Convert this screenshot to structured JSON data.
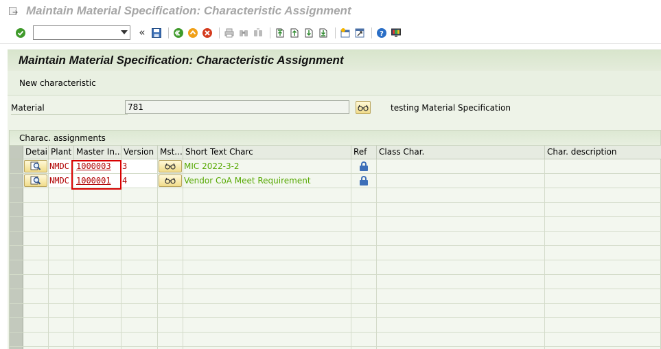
{
  "window": {
    "title": "Maintain Material Specification: Characteristic Assignment"
  },
  "toolbar": {
    "command_value": "",
    "icons": [
      "enter-check-icon",
      "back-double-chevron-icon",
      "save-icon",
      "back-icon",
      "exit-icon",
      "cancel-icon",
      "print-icon",
      "find-icon",
      "find-next-icon",
      "first-page-icon",
      "previous-page-icon",
      "next-page-icon",
      "last-page-icon",
      "create-session-icon",
      "shortcut-icon",
      "help-icon",
      "customize-layout-icon"
    ]
  },
  "header": {
    "title": "Maintain Material Specification: Characteristic Assignment"
  },
  "app_toolbar": {
    "new_characteristic": "New characteristic"
  },
  "material": {
    "label": "Material",
    "value": "781",
    "description": "testing Material Specification"
  },
  "assignments": {
    "title": "Charac. assignments",
    "columns": {
      "detail": "Detail",
      "plant": "Plant",
      "master": "Master In...",
      "version": "Version",
      "mst": "Mst...",
      "short_text": "Short Text Charc",
      "ref": "Ref",
      "class_char": "Class Char.",
      "char_desc": "Char. description"
    },
    "rows": [
      {
        "plant": "NMDC",
        "master": "1000003",
        "version": "3",
        "short_text": "MIC 2022-3-2",
        "class_char": "",
        "char_desc": ""
      },
      {
        "plant": "NMDC",
        "master": "1000001",
        "version": "4",
        "short_text": "Vendor CoA Meet Requirement",
        "class_char": "",
        "char_desc": ""
      }
    ]
  },
  "colors": {
    "header_green": "#d8e5cc",
    "body_green": "#eef3e8",
    "link_red": "#b00000",
    "text_green": "#55a800",
    "highlight_red": "#d80000"
  }
}
